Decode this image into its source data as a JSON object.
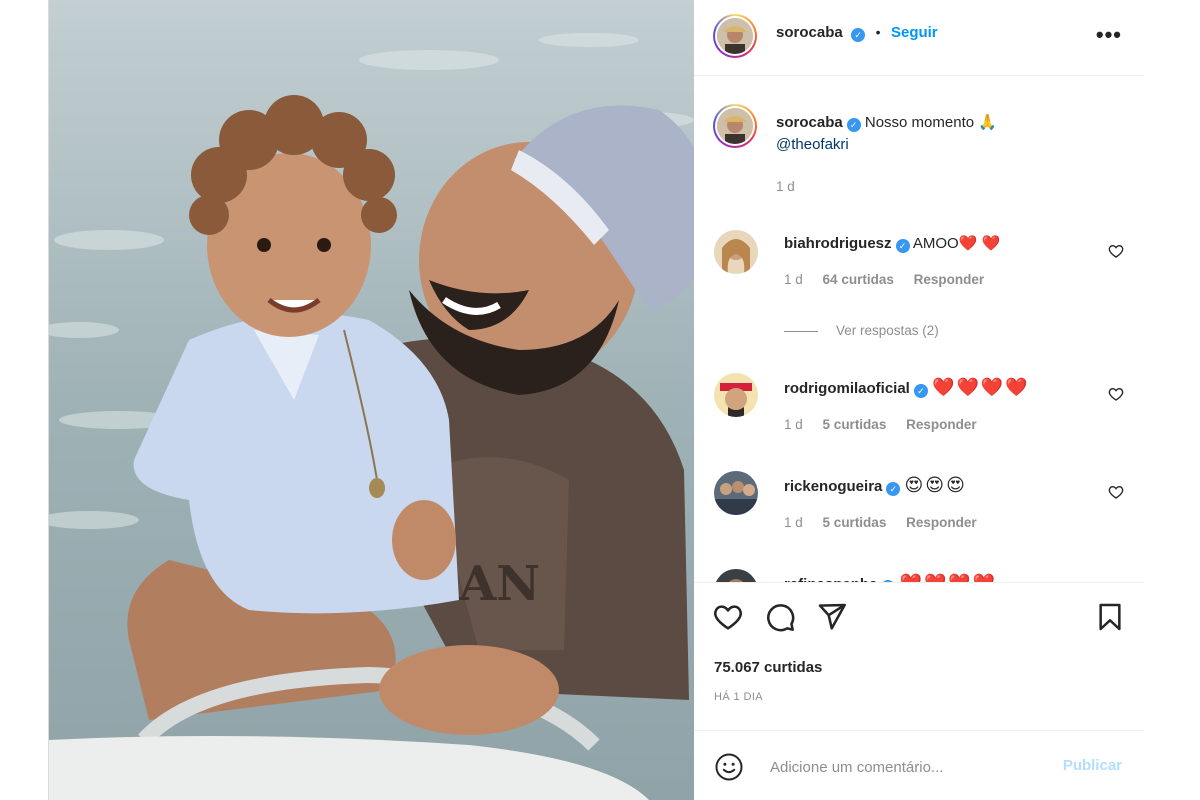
{
  "header": {
    "username": "sorocaba",
    "verified_mark": "✓",
    "separator": "•",
    "follow_label": "Seguir",
    "more_label": "•••"
  },
  "caption": {
    "username": "sorocaba",
    "text": "Nosso momento 🙏",
    "mention": "@theofakri",
    "time": "1 d"
  },
  "comments": [
    {
      "username": "biahrodriguesz",
      "text": "AMOO❤️ ❤️",
      "time": "1 d",
      "likes": "64 curtidas",
      "reply_label": "Responder",
      "view_replies": "Ver respostas (2)"
    },
    {
      "username": "rodrigomilaoficial",
      "text": "❤️❤️❤️❤️",
      "time": "1 d",
      "likes": "5 curtidas",
      "reply_label": "Responder"
    },
    {
      "username": "rickenogueira",
      "text": "😍😍😍",
      "time": "1 d",
      "likes": "5 curtidas",
      "reply_label": "Responder"
    },
    {
      "username": "rafinaspenha",
      "text": "❤️❤️❤️❤️"
    }
  ],
  "post": {
    "likes": "75.067 curtidas",
    "date": "HÁ 1 DIA"
  },
  "compose": {
    "placeholder": "Adicione um comentário...",
    "publish_label": "Publicar"
  },
  "colors": {
    "accent": "#0095f6",
    "verified": "#3897f0",
    "muted": "#8e8e8e",
    "publish_disabled": "#b2dffc"
  },
  "icons": [
    "heart-icon",
    "comment-icon",
    "share-icon",
    "save-icon",
    "emoji-icon",
    "more-icon"
  ]
}
